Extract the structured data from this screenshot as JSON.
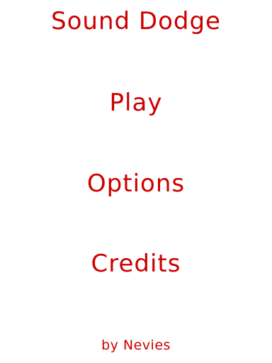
{
  "title": "Sound Dodge",
  "menu": {
    "play": "Play",
    "options": "Options",
    "credits": "Credits"
  },
  "byline": "by Nevies",
  "colors": {
    "background": "#ffffff",
    "text": "#cc0000"
  }
}
